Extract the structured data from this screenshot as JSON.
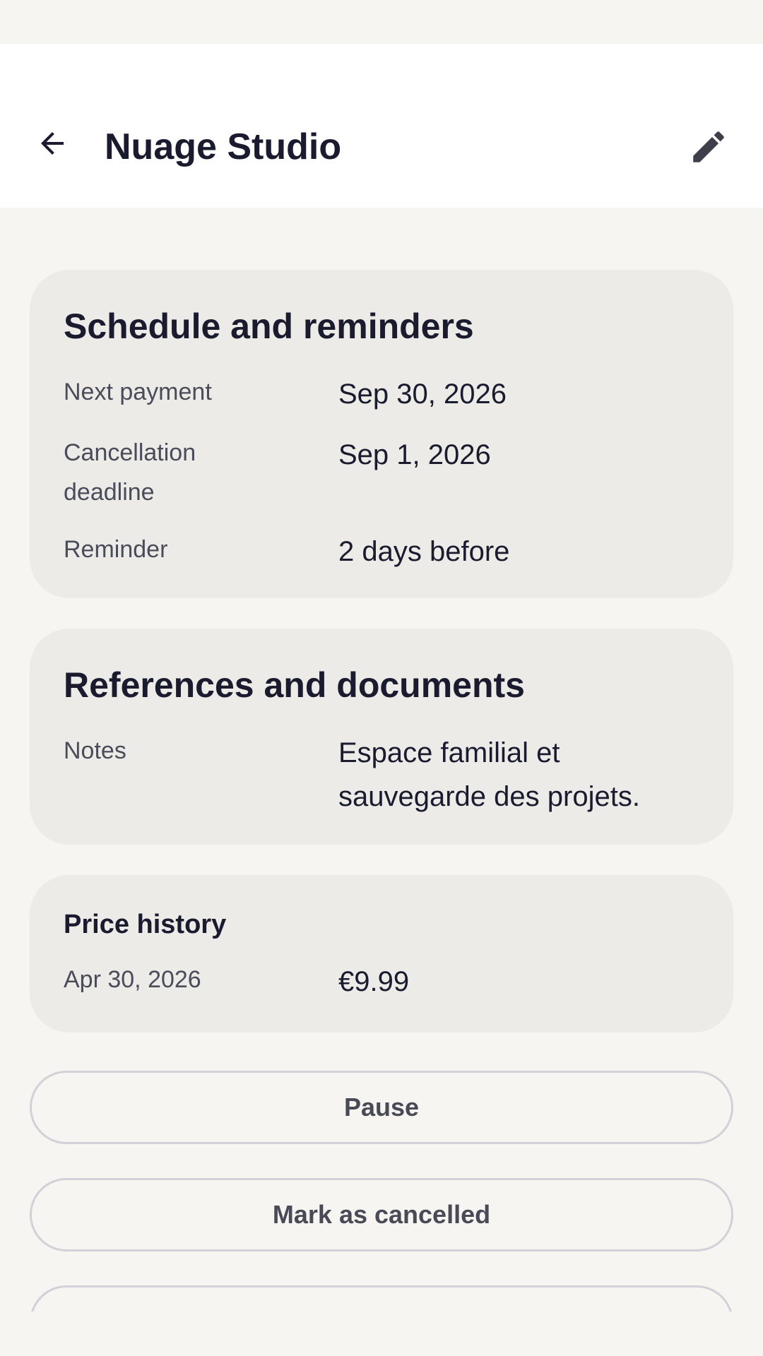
{
  "header": {
    "title": "Nuage Studio",
    "back_icon": "arrow-back-icon",
    "edit_icon": "pencil-icon"
  },
  "schedule": {
    "title": "Schedule and reminders",
    "rows": [
      {
        "label": "Next payment",
        "value": "Sep 30, 2026"
      },
      {
        "label": "Cancellation deadline",
        "value": "Sep 1, 2026"
      },
      {
        "label": "Reminder",
        "value": "2 days before"
      }
    ]
  },
  "references": {
    "title": "References and documents",
    "rows": [
      {
        "label": "Notes",
        "value": "Espace familial et sauvegarde des projets."
      }
    ]
  },
  "price_history": {
    "title": "Price history",
    "rows": [
      {
        "label": "Apr 30, 2026",
        "value": "€9.99"
      }
    ]
  },
  "actions": {
    "pause_label": "Pause",
    "cancel_label": "Mark as cancelled"
  },
  "colors": {
    "background": "#f6f5f2",
    "card": "#ecebe8",
    "text": "#1a1b2e",
    "muted_text": "#4b4c5a",
    "button_border": "#d3d1d8"
  }
}
